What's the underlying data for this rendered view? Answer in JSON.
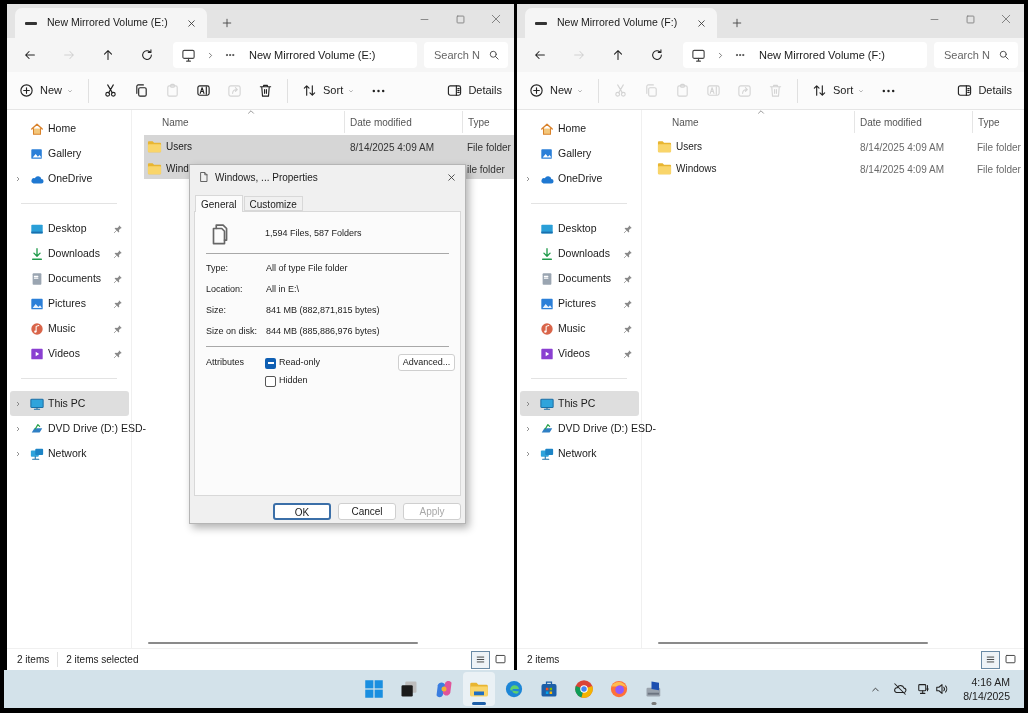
{
  "explorer_windows": [
    {
      "tab": {
        "title": "New Mirrored Volume (E:)"
      },
      "nav_buttons": [
        {
          "kind": "back",
          "disabled": false
        },
        {
          "kind": "forward",
          "disabled": true
        },
        {
          "kind": "up",
          "disabled": false
        },
        {
          "kind": "refresh",
          "disabled": false
        }
      ],
      "breadcrumb": "New Mirrored Volume (E:)",
      "search": {
        "placeholder": "Search N"
      },
      "toolbar": [
        {
          "kind": "new",
          "label": "New",
          "disabled": false
        },
        {
          "kind": "cut",
          "disabled": false
        },
        {
          "kind": "copy",
          "disabled": false
        },
        {
          "kind": "paste",
          "disabled": true
        },
        {
          "kind": "rename",
          "disabled": false
        },
        {
          "kind": "share",
          "disabled": true
        },
        {
          "kind": "delete",
          "disabled": false
        },
        {
          "kind": "sort",
          "label": "Sort",
          "disabled": false
        },
        {
          "kind": "more",
          "disabled": false
        },
        {
          "kind": "details",
          "label": "Details",
          "disabled": false
        }
      ],
      "sidebar": {
        "groups": [
          [
            {
              "kind": "home",
              "label": "Home",
              "expandable": false,
              "pinned": false,
              "selected": false
            },
            {
              "kind": "gallery",
              "label": "Gallery",
              "expandable": false,
              "pinned": false,
              "selected": false
            },
            {
              "kind": "onedrive",
              "label": "OneDrive",
              "expandable": true,
              "pinned": false,
              "selected": false
            }
          ],
          [
            {
              "kind": "desktop",
              "label": "Desktop",
              "expandable": false,
              "pinned": true,
              "selected": false
            },
            {
              "kind": "downloads",
              "label": "Downloads",
              "expandable": false,
              "pinned": true,
              "selected": false
            },
            {
              "kind": "documents",
              "label": "Documents",
              "expandable": false,
              "pinned": true,
              "selected": false
            },
            {
              "kind": "pictures",
              "label": "Pictures",
              "expandable": false,
              "pinned": true,
              "selected": false
            },
            {
              "kind": "music",
              "label": "Music",
              "expandable": false,
              "pinned": true,
              "selected": false
            },
            {
              "kind": "videos",
              "label": "Videos",
              "expandable": false,
              "pinned": true,
              "selected": false
            }
          ],
          [
            {
              "kind": "thispc",
              "label": "This PC",
              "expandable": true,
              "pinned": false,
              "selected": true
            },
            {
              "kind": "dvd",
              "label": "DVD Drive (D:) ESD-",
              "expandable": true,
              "pinned": false,
              "selected": false
            },
            {
              "kind": "network",
              "label": "Network",
              "expandable": true,
              "pinned": false,
              "selected": false
            }
          ]
        ]
      },
      "columns": [
        "Name",
        "Date modified",
        "Type"
      ],
      "rows": [
        {
          "name": "Users",
          "date_modified": "8/14/2025 4:09 AM",
          "type": "File folder",
          "selected": true
        },
        {
          "name": "Wind",
          "type": "ile folder",
          "selected": true
        }
      ],
      "status": [
        "2 items",
        "2 items selected"
      ],
      "view_buttons": [
        {
          "kind": "details",
          "selected": true
        },
        {
          "kind": "tiles",
          "selected": false
        }
      ]
    },
    {
      "tab": {
        "title": "New Mirrored Volume (F:)"
      },
      "nav_buttons": [
        {
          "kind": "back",
          "disabled": false
        },
        {
          "kind": "forward",
          "disabled": true
        },
        {
          "kind": "up",
          "disabled": false
        },
        {
          "kind": "refresh",
          "disabled": false
        }
      ],
      "breadcrumb": "New Mirrored Volume (F:)",
      "search": {
        "placeholder": "Search N"
      },
      "toolbar": [
        {
          "kind": "new",
          "label": "New",
          "disabled": false
        },
        {
          "kind": "cut",
          "disabled": true
        },
        {
          "kind": "copy",
          "disabled": true
        },
        {
          "kind": "paste",
          "disabled": true
        },
        {
          "kind": "rename",
          "disabled": true
        },
        {
          "kind": "share",
          "disabled": true
        },
        {
          "kind": "delete",
          "disabled": true
        },
        {
          "kind": "sort",
          "label": "Sort",
          "disabled": false
        },
        {
          "kind": "more",
          "disabled": false
        },
        {
          "kind": "details",
          "label": "Details",
          "disabled": false
        }
      ],
      "sidebar": {
        "groups": [
          [
            {
              "kind": "home",
              "label": "Home",
              "expandable": false,
              "pinned": false,
              "selected": false
            },
            {
              "kind": "gallery",
              "label": "Gallery",
              "expandable": false,
              "pinned": false,
              "selected": false
            },
            {
              "kind": "onedrive",
              "label": "OneDrive",
              "expandable": true,
              "pinned": false,
              "selected": false
            }
          ],
          [
            {
              "kind": "desktop",
              "label": "Desktop",
              "expandable": false,
              "pinned": true,
              "selected": false
            },
            {
              "kind": "downloads",
              "label": "Downloads",
              "expandable": false,
              "pinned": true,
              "selected": false
            },
            {
              "kind": "documents",
              "label": "Documents",
              "expandable": false,
              "pinned": true,
              "selected": false
            },
            {
              "kind": "pictures",
              "label": "Pictures",
              "expandable": false,
              "pinned": true,
              "selected": false
            },
            {
              "kind": "music",
              "label": "Music",
              "expandable": false,
              "pinned": true,
              "selected": false
            },
            {
              "kind": "videos",
              "label": "Videos",
              "expandable": false,
              "pinned": true,
              "selected": false
            }
          ],
          [
            {
              "kind": "thispc",
              "label": "This PC",
              "expandable": true,
              "pinned": false,
              "selected": true
            },
            {
              "kind": "dvd",
              "label": "DVD Drive (D:) ESD-",
              "expandable": true,
              "pinned": false,
              "selected": false
            },
            {
              "kind": "network",
              "label": "Network",
              "expandable": true,
              "pinned": false,
              "selected": false
            }
          ]
        ]
      },
      "columns": [
        "Name",
        "Date modified",
        "Type"
      ],
      "rows": [
        {
          "name": "Users",
          "date_modified": "8/14/2025 4:09 AM",
          "type": "File folder",
          "selected": false
        },
        {
          "name": "Windows",
          "date_modified": "8/14/2025 4:09 AM",
          "type": "File folder",
          "selected": false
        }
      ],
      "status": [
        "2 items"
      ],
      "view_buttons": [
        {
          "kind": "details",
          "selected": true
        },
        {
          "kind": "tiles",
          "selected": false
        }
      ]
    }
  ],
  "dialog": {
    "title": "Windows, ... Properties",
    "tabs": [
      {
        "label": "General",
        "selected": true
      },
      {
        "label": "Customize",
        "selected": false
      }
    ],
    "summary": "1,594 Files, 587 Folders",
    "properties": [
      {
        "label": "Type:",
        "value": "All of type File folder"
      },
      {
        "label": "Location:",
        "value": "All in E:\\"
      },
      {
        "label": "Size:",
        "value": "841 MB (882,871,815 bytes)"
      },
      {
        "label": "Size on disk:",
        "value": "844 MB (885,886,976 bytes)"
      }
    ],
    "attributes": {
      "label": "Attributes",
      "checkboxes": [
        {
          "label": "Read-only",
          "checked": true,
          "indeterminate": true
        },
        {
          "label": "Hidden",
          "checked": false
        }
      ],
      "advanced_button": "Advanced..."
    },
    "buttons": [
      {
        "label": "OK",
        "default": true,
        "disabled": false
      },
      {
        "label": "Cancel",
        "default": false,
        "disabled": false
      },
      {
        "label": "Apply",
        "default": false,
        "disabled": true
      }
    ]
  },
  "taskbar": {
    "apps": [
      {
        "kind": "start",
        "active": false,
        "running": false
      },
      {
        "kind": "taskview",
        "active": false,
        "running": false
      },
      {
        "kind": "copilot",
        "active": false,
        "running": false
      },
      {
        "kind": "explorer",
        "active": true,
        "running": true
      },
      {
        "kind": "edge",
        "active": false,
        "running": false
      },
      {
        "kind": "store",
        "active": false,
        "running": false
      },
      {
        "kind": "chrome",
        "active": false,
        "running": false
      },
      {
        "kind": "firefox",
        "active": false,
        "running": false
      },
      {
        "kind": "setup",
        "active": false,
        "running": true
      }
    ],
    "time": "4:16 AM",
    "date": "8/14/2025"
  }
}
